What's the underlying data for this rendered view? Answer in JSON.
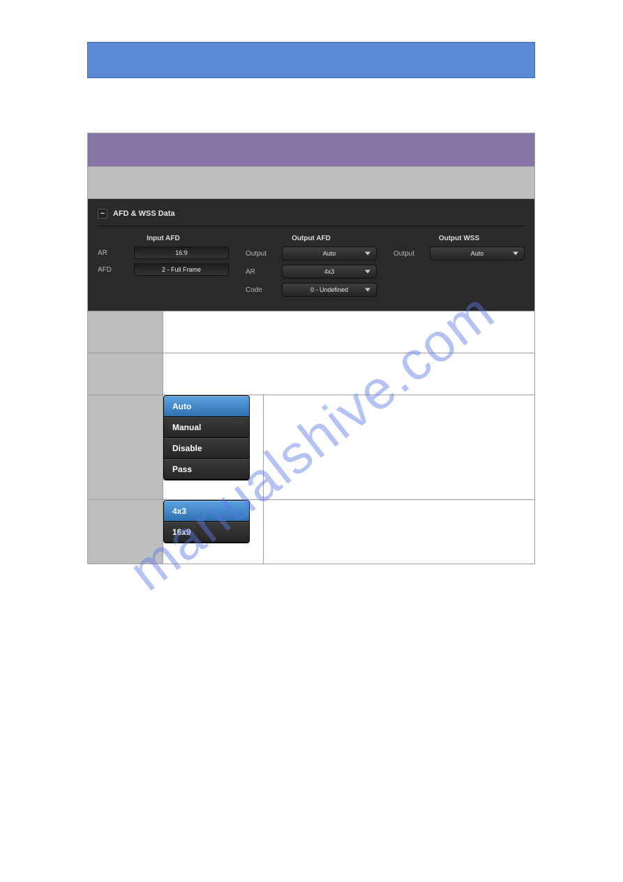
{
  "watermark": "manualshive.com",
  "panel": {
    "title": "AFD & WSS Data",
    "collapse_glyph": "−",
    "input": {
      "header": "Input AFD",
      "ar_label": "AR",
      "ar_value": "16:9",
      "afd_label": "AFD",
      "afd_value": "2 - Full Frame"
    },
    "output_afd": {
      "header": "Output AFD",
      "output_label": "Output",
      "output_value": "Auto",
      "ar_label": "AR",
      "ar_value": "4x3",
      "code_label": "Code",
      "code_value": "0 - Undefined"
    },
    "output_wss": {
      "header": "Output WSS",
      "output_label": "Output",
      "output_value": "Auto"
    }
  },
  "menu1": {
    "items": [
      "Auto",
      "Manual",
      "Disable",
      "Pass"
    ],
    "selected": 0
  },
  "menu2": {
    "items": [
      "4x3",
      "16x9"
    ],
    "selected": 0
  }
}
